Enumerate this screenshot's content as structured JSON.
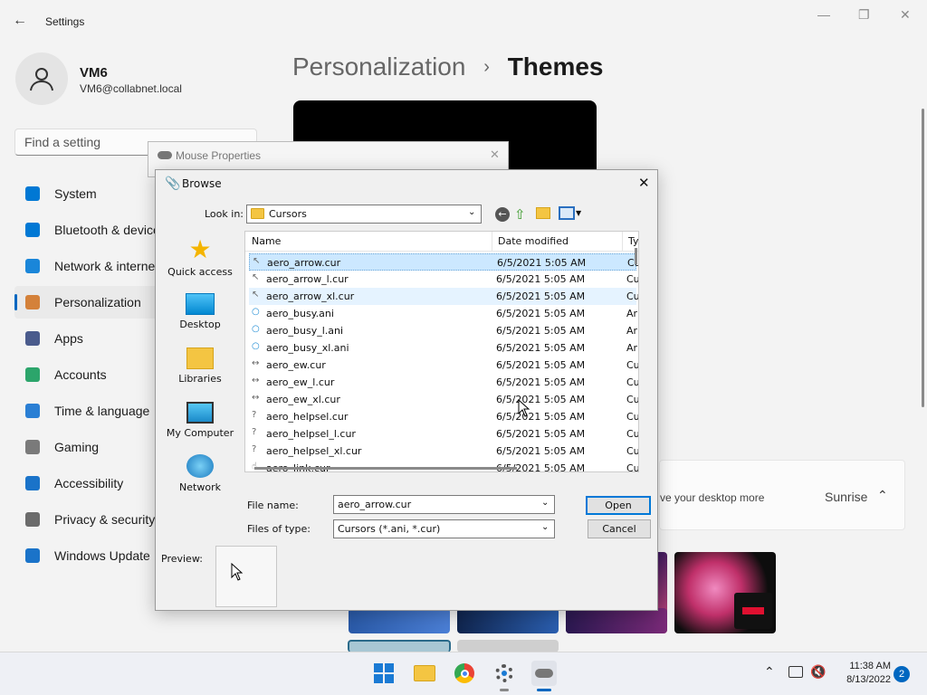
{
  "settings": {
    "title": "Settings",
    "user": {
      "name": "VM6",
      "email": "VM6@collabnet.local"
    },
    "search_placeholder": "Find a setting",
    "nav": [
      {
        "label": "System",
        "color": "#0078d4"
      },
      {
        "label": "Bluetooth & devices",
        "color": "#0078d4"
      },
      {
        "label": "Network & internet",
        "color": "#1a86d9"
      },
      {
        "label": "Personalization",
        "color": "#d4813a"
      },
      {
        "label": "Apps",
        "color": "#4a5b8c"
      },
      {
        "label": "Accounts",
        "color": "#2ca56b"
      },
      {
        "label": "Time & language",
        "color": "#2a7fd4"
      },
      {
        "label": "Gaming",
        "color": "#7a7a7a"
      },
      {
        "label": "Accessibility",
        "color": "#1a73c9"
      },
      {
        "label": "Privacy & security",
        "color": "#6b6b6b"
      },
      {
        "label": "Windows Update",
        "color": "#1a73c9"
      }
    ],
    "breadcrumb": {
      "parent": "Personalization",
      "current": "Themes"
    },
    "theme_panel": {
      "desc": "ve your desktop more",
      "selected": "Sunrise"
    }
  },
  "mouse_properties": {
    "title": "Mouse Properties"
  },
  "browse": {
    "title": "Browse",
    "look_in_label": "Look in:",
    "look_in_value": "Cursors",
    "places": [
      "Quick access",
      "Desktop",
      "Libraries",
      "My Computer",
      "Network"
    ],
    "columns": {
      "name": "Name",
      "date": "Date modified",
      "type": "Ty"
    },
    "files": [
      {
        "name": "aero_arrow.cur",
        "date": "6/5/2021 5:05 AM",
        "type": "Cu",
        "icon": "arrow-cursor-icon"
      },
      {
        "name": "aero_arrow_l.cur",
        "date": "6/5/2021 5:05 AM",
        "type": "Cu",
        "icon": "arrow-cursor-icon"
      },
      {
        "name": "aero_arrow_xl.cur",
        "date": "6/5/2021 5:05 AM",
        "type": "Cu",
        "icon": "arrow-cursor-icon"
      },
      {
        "name": "aero_busy.ani",
        "date": "6/5/2021 5:05 AM",
        "type": "Ar",
        "icon": "busy-cursor-icon"
      },
      {
        "name": "aero_busy_l.ani",
        "date": "6/5/2021 5:05 AM",
        "type": "Ar",
        "icon": "busy-cursor-icon"
      },
      {
        "name": "aero_busy_xl.ani",
        "date": "6/5/2021 5:05 AM",
        "type": "Ar",
        "icon": "busy-cursor-icon"
      },
      {
        "name": "aero_ew.cur",
        "date": "6/5/2021 5:05 AM",
        "type": "Cu",
        "icon": "resize-ew-icon"
      },
      {
        "name": "aero_ew_l.cur",
        "date": "6/5/2021 5:05 AM",
        "type": "Cu",
        "icon": "resize-ew-icon"
      },
      {
        "name": "aero_ew_xl.cur",
        "date": "6/5/2021 5:05 AM",
        "type": "Cu",
        "icon": "resize-ew-icon"
      },
      {
        "name": "aero_helpsel.cur",
        "date": "6/5/2021 5:05 AM",
        "type": "Cu",
        "icon": "help-cursor-icon"
      },
      {
        "name": "aero_helpsel_l.cur",
        "date": "6/5/2021 5:05 AM",
        "type": "Cu",
        "icon": "help-cursor-icon"
      },
      {
        "name": "aero_helpsel_xl.cur",
        "date": "6/5/2021 5:05 AM",
        "type": "Cu",
        "icon": "help-cursor-icon"
      },
      {
        "name": "aero_link.cur",
        "date": "6/5/2021 5:05 AM",
        "type": "Cu",
        "icon": "hand-cursor-icon"
      }
    ],
    "file_name_label": "File name:",
    "file_name_value": "aero_arrow.cur",
    "file_type_label": "Files of type:",
    "file_type_value": "Cursors (*.ani, *.cur)",
    "open_label": "Open",
    "cancel_label": "Cancel",
    "preview_label": "Preview:"
  },
  "taskbar": {
    "time": "11:38 AM",
    "date": "8/13/2022",
    "notification_count": "2"
  },
  "colors": {
    "accent": "#0067c0",
    "selection": "#cce8ff",
    "dialog_bg": "#f0f0f0"
  }
}
